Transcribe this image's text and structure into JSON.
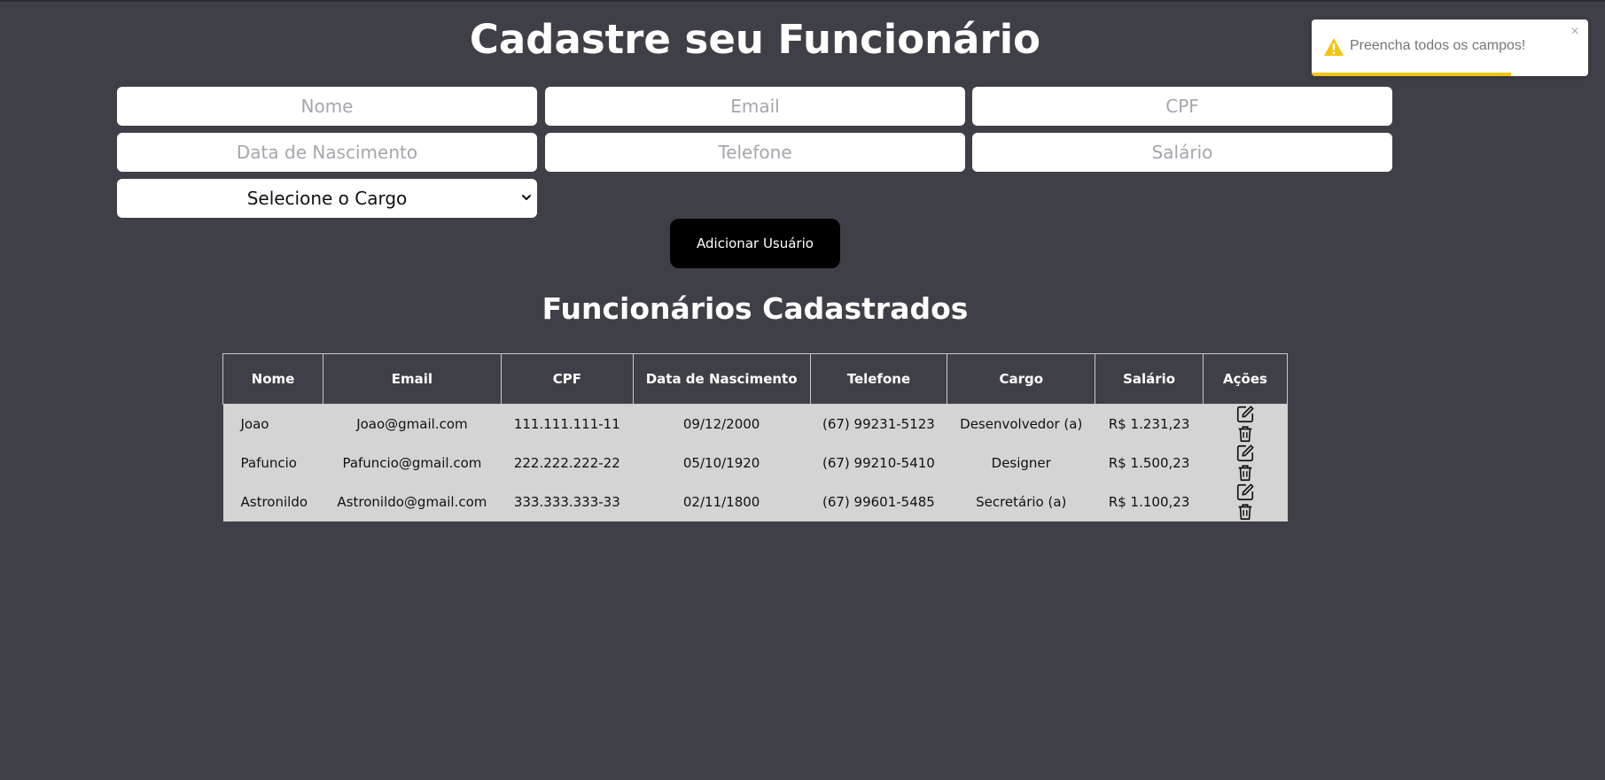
{
  "header": {
    "title": "Cadastre seu Funcionário"
  },
  "form": {
    "name_placeholder": "Nome",
    "email_placeholder": "Email",
    "cpf_placeholder": "CPF",
    "birthdate_placeholder": "Data de Nascimento",
    "phone_placeholder": "Telefone",
    "salary_placeholder": "Salário",
    "role_select": "Selecione o Cargo",
    "submit_label": "Adicionar Usuário"
  },
  "table": {
    "title": "Funcionários Cadastrados",
    "columns": [
      "Nome",
      "Email",
      "CPF",
      "Data de Nascimento",
      "Telefone",
      "Cargo",
      "Salário",
      "Ações"
    ],
    "rows": [
      [
        "Joao",
        "Joao@gmail.com",
        "111.111.111-11",
        "09/12/2000",
        "(67) 99231-5123",
        "Desenvolvedor (a)",
        "R$ 1.231,23"
      ],
      [
        "Pafuncio",
        "Pafuncio@gmail.com",
        "222.222.222-22",
        "05/10/1920",
        "(67) 99210-5410",
        "Designer",
        "R$ 1.500,23"
      ],
      [
        "Astronildo",
        "Astronildo@gmail.com",
        "333.333.333-33",
        "02/11/1800",
        "(67) 99601-5485",
        "Secretário (a)",
        "R$ 1.100,23"
      ]
    ],
    "row_actions": [
      "edit-icon",
      "trash-icon"
    ]
  },
  "toast": {
    "message": "Preencha todos os campos!",
    "icon": "warning-icon",
    "close_label": "×",
    "progress": 0.72,
    "accent_color": "#f1c40f"
  },
  "colors": {
    "background": "#3f4047",
    "row_background": "#d4d4d4",
    "button": "#000000"
  }
}
